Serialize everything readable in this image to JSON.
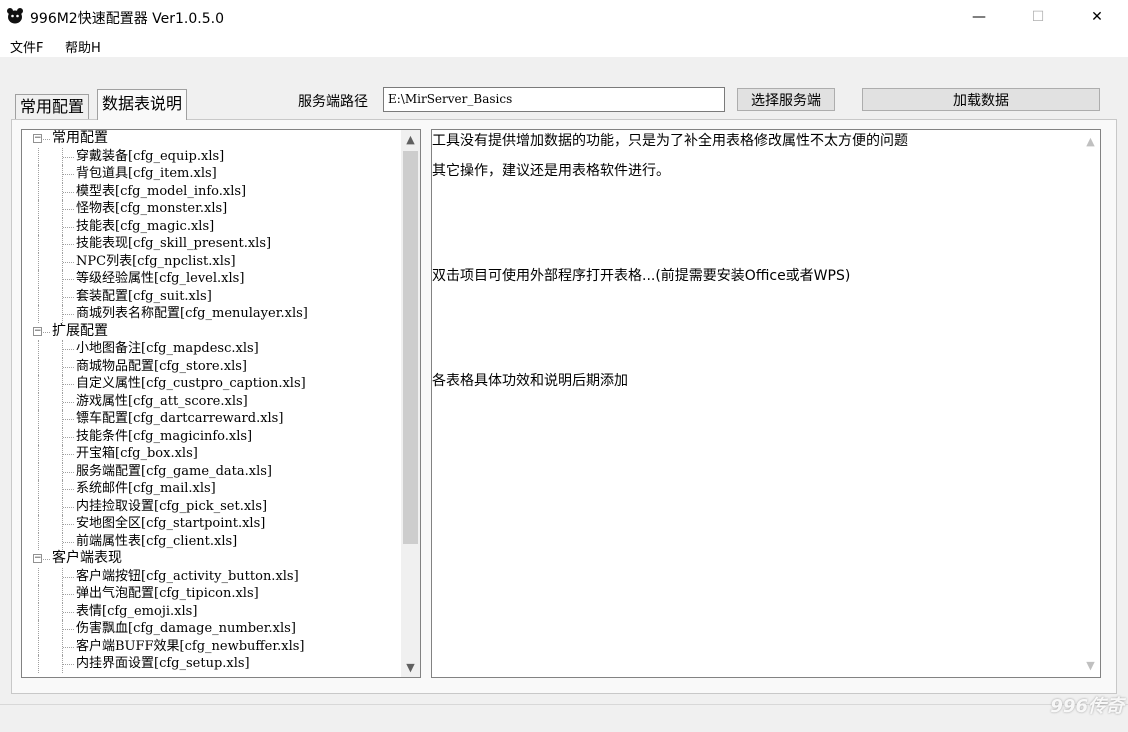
{
  "window": {
    "title": "996M2快速配置器 Ver1.0.5.0",
    "minimize": "—",
    "maximize": "☐",
    "close": "✕"
  },
  "menu": [
    "文件F",
    "帮助H"
  ],
  "tabs": [
    "常用配置",
    "数据表说明"
  ],
  "server": {
    "path_label": "服务端路径",
    "path_value": "E:\\MirServer_Basics",
    "select_button": "选择服务端",
    "load_button": "加载数据"
  },
  "tree": [
    {
      "label": "常用配置",
      "items": [
        "穿戴装备[cfg_equip.xls]",
        "背包道具[cfg_item.xls]",
        "模型表[cfg_model_info.xls]",
        "怪物表[cfg_monster.xls]",
        "技能表[cfg_magic.xls]",
        "技能表现[cfg_skill_present.xls]",
        "NPC列表[cfg_npclist.xls]",
        "等级经验属性[cfg_level.xls]",
        "套装配置[cfg_suit.xls]",
        "商城列表名称配置[cfg_menulayer.xls]"
      ]
    },
    {
      "label": "扩展配置",
      "items": [
        "小地图备注[cfg_mapdesc.xls]",
        "商城物品配置[cfg_store.xls]",
        "自定义属性[cfg_custpro_caption.xls]",
        "游戏属性[cfg_att_score.xls]",
        "镖车配置[cfg_dartcarreward.xls]",
        "技能条件[cfg_magicinfo.xls]",
        "开宝箱[cfg_box.xls]",
        "服务端配置[cfg_game_data.xls]",
        "系统邮件[cfg_mail.xls]",
        "内挂捡取设置[cfg_pick_set.xls]",
        "安地图全区[cfg_startpoint.xls]",
        "前端属性表[cfg_client.xls]"
      ]
    },
    {
      "label": "客户端表现",
      "items": [
        "客户端按钮[cfg_activity_button.xls]",
        "弹出气泡配置[cfg_tipicon.xls]",
        "表情[cfg_emoji.xls]",
        "伤害飘血[cfg_damage_number.xls]",
        "客户端BUFF效果[cfg_newbuffer.xls]",
        "内挂界面设置[cfg_setup.xls]"
      ]
    }
  ],
  "description": [
    "工具没有提供增加数据的功能，只是为了补全用表格修改属性不太方便的问题",
    "其它操作，建议还是用表格软件进行。",
    "双击项目可使用外部程序打开表格...(前提需要安装Office或者WPS)",
    "各表格具体功效和说明后期添加"
  ],
  "watermark": "996传奇"
}
